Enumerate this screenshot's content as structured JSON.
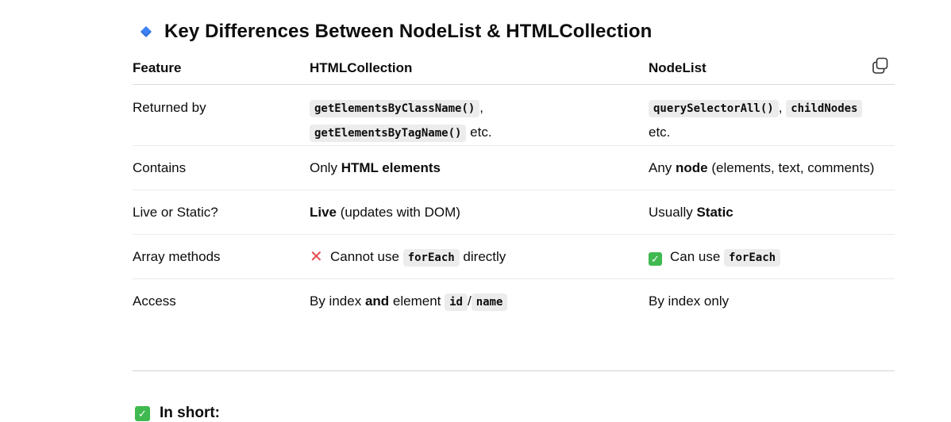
{
  "heading": {
    "text": "Key Differences Between NodeList & HTMLCollection",
    "icon": "blue-diamond-icon"
  },
  "table": {
    "headers": [
      "Feature",
      "HTMLCollection",
      "NodeList"
    ],
    "rows": [
      {
        "feature": "Returned by",
        "html": {
          "code1": "getElementsByClassName()",
          "sep": ",",
          "code2": "getElementsByTagName()",
          "suffix": " etc."
        },
        "node": {
          "code1": "querySelectorAll()",
          "sep": ",",
          "code2": "childNodes",
          "suffix": "etc."
        }
      },
      {
        "feature": "Contains",
        "html": {
          "pre": "Only ",
          "bold": "HTML elements"
        },
        "node": {
          "pre": "Any ",
          "bold": "node",
          "post": " (elements, text, comments)"
        }
      },
      {
        "feature": "Live or Static?",
        "html": {
          "bold": "Live",
          "post": " (updates with DOM)"
        },
        "node": {
          "pre": "Usually ",
          "bold": "Static"
        }
      },
      {
        "feature": "Array methods",
        "html": {
          "icon": "cross-mark-icon",
          "pre": "Cannot use ",
          "code": "forEach",
          "post": " directly"
        },
        "node": {
          "icon": "check-mark-icon",
          "pre": "Can use ",
          "code": "forEach"
        }
      },
      {
        "feature": "Access",
        "html": {
          "pre": "By index ",
          "bold": "and",
          "mid": " element ",
          "code1": "id",
          "sep": "/",
          "code2": "name"
        },
        "node": {
          "text": "By index only"
        }
      }
    ]
  },
  "summary": {
    "text": "In short:",
    "icon": "check-mark-icon"
  },
  "colors": {
    "diamond": "#3b82f6",
    "check": "#3fb950",
    "cross": "#e5484d"
  }
}
